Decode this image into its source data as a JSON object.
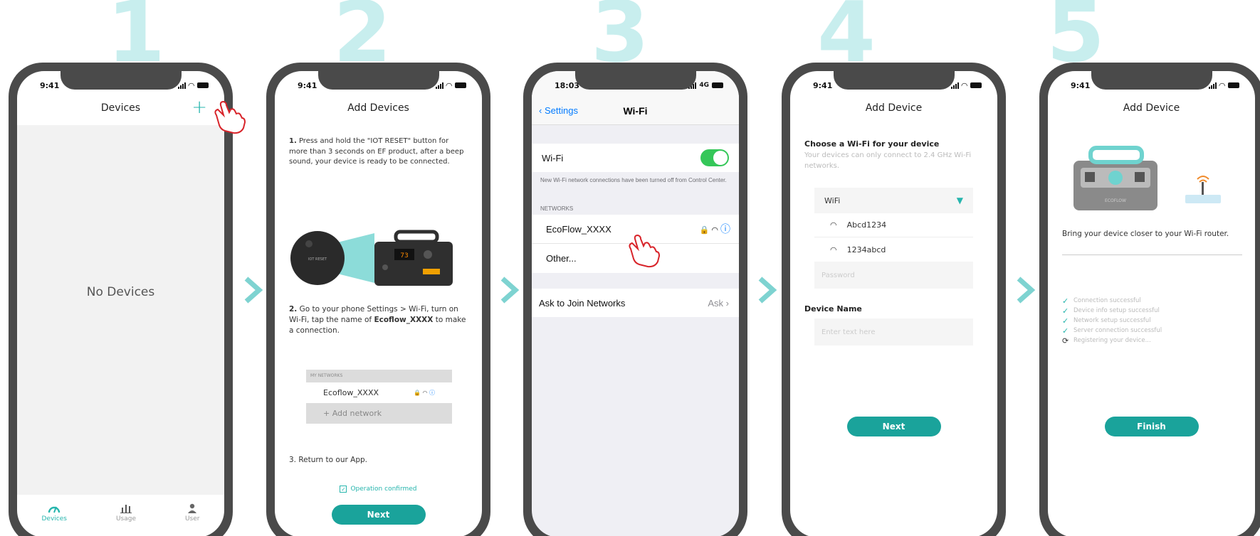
{
  "steps": [
    "1",
    "2",
    "3",
    "4",
    "5"
  ],
  "colors": {
    "accent": "#26b5ad",
    "button": "#1aa39b",
    "step_number": "#c8eeee",
    "chevron": "#7ed3d1"
  },
  "phone1": {
    "time": "9:41",
    "title": "Devices",
    "add_icon": "+",
    "empty_text": "No Devices",
    "tabs": [
      {
        "label": "Devices",
        "icon": "gauge-icon",
        "active": true
      },
      {
        "label": "Usage",
        "icon": "bar-chart-icon",
        "active": false
      },
      {
        "label": "User",
        "icon": "person-icon",
        "active": false
      }
    ]
  },
  "phone2": {
    "time": "9:41",
    "title": "Add Devices",
    "step1_num": "1.",
    "step1_text": "Press and hold the \"IOT RESET\" button for more than 3 seconds on EF product, after a beep sound, your device is ready to be connected.",
    "reset_label": "IOT RESET",
    "step2_num": "2.",
    "step2_text_a": "Go to your phone Settings > Wi-Fi, turn on Wi-Fi, tap the name of ",
    "step2_bold": "Ecoflow_XXXX",
    "step2_text_b": " to make a connection.",
    "mini_header": "MY NETWORKS",
    "mini_network": "Ecoflow_XXXX",
    "mini_add": "+ Add network",
    "step3_text": "3. Return to our App.",
    "confirm_label": "Operation confirmed",
    "next_label": "Next"
  },
  "phone3": {
    "time": "18:03",
    "carrier": "4G",
    "back_label": "Settings",
    "title": "Wi-Fi",
    "wifi_label": "Wi-Fi",
    "wifi_on": true,
    "note": "New Wi-Fi network connections have been turned off from Control Center.",
    "networks_header": "NETWORKS",
    "network": "EcoFlow_XXXX",
    "other": "Other...",
    "ask_label": "Ask to Join Networks",
    "ask_value": "Ask"
  },
  "phone4": {
    "time": "9:41",
    "title": "Add Device",
    "choose_heading": "Choose a Wi-Fi for your device",
    "choose_sub": "Your devices can only connect to 2.4 GHz Wi-Fi networks.",
    "wifi_select": "WiFi",
    "networks": [
      "Abcd1234",
      "1234abcd"
    ],
    "password_placeholder": "Password",
    "device_name_heading": "Device Name",
    "device_name_placeholder": "Enter text here",
    "next_label": "Next"
  },
  "phone5": {
    "time": "9:41",
    "title": "Add Device",
    "device_brand": "ECOFLOW",
    "closer_text": "Bring your device closer to your Wi-Fi router.",
    "statuses": [
      {
        "text": "Connection successful",
        "done": true
      },
      {
        "text": "Device info setup successful",
        "done": true
      },
      {
        "text": "Network setup successful",
        "done": true
      },
      {
        "text": "Server connection successful",
        "done": true
      },
      {
        "text": "Registering your device...",
        "done": false
      }
    ],
    "finish_label": "Finish"
  }
}
